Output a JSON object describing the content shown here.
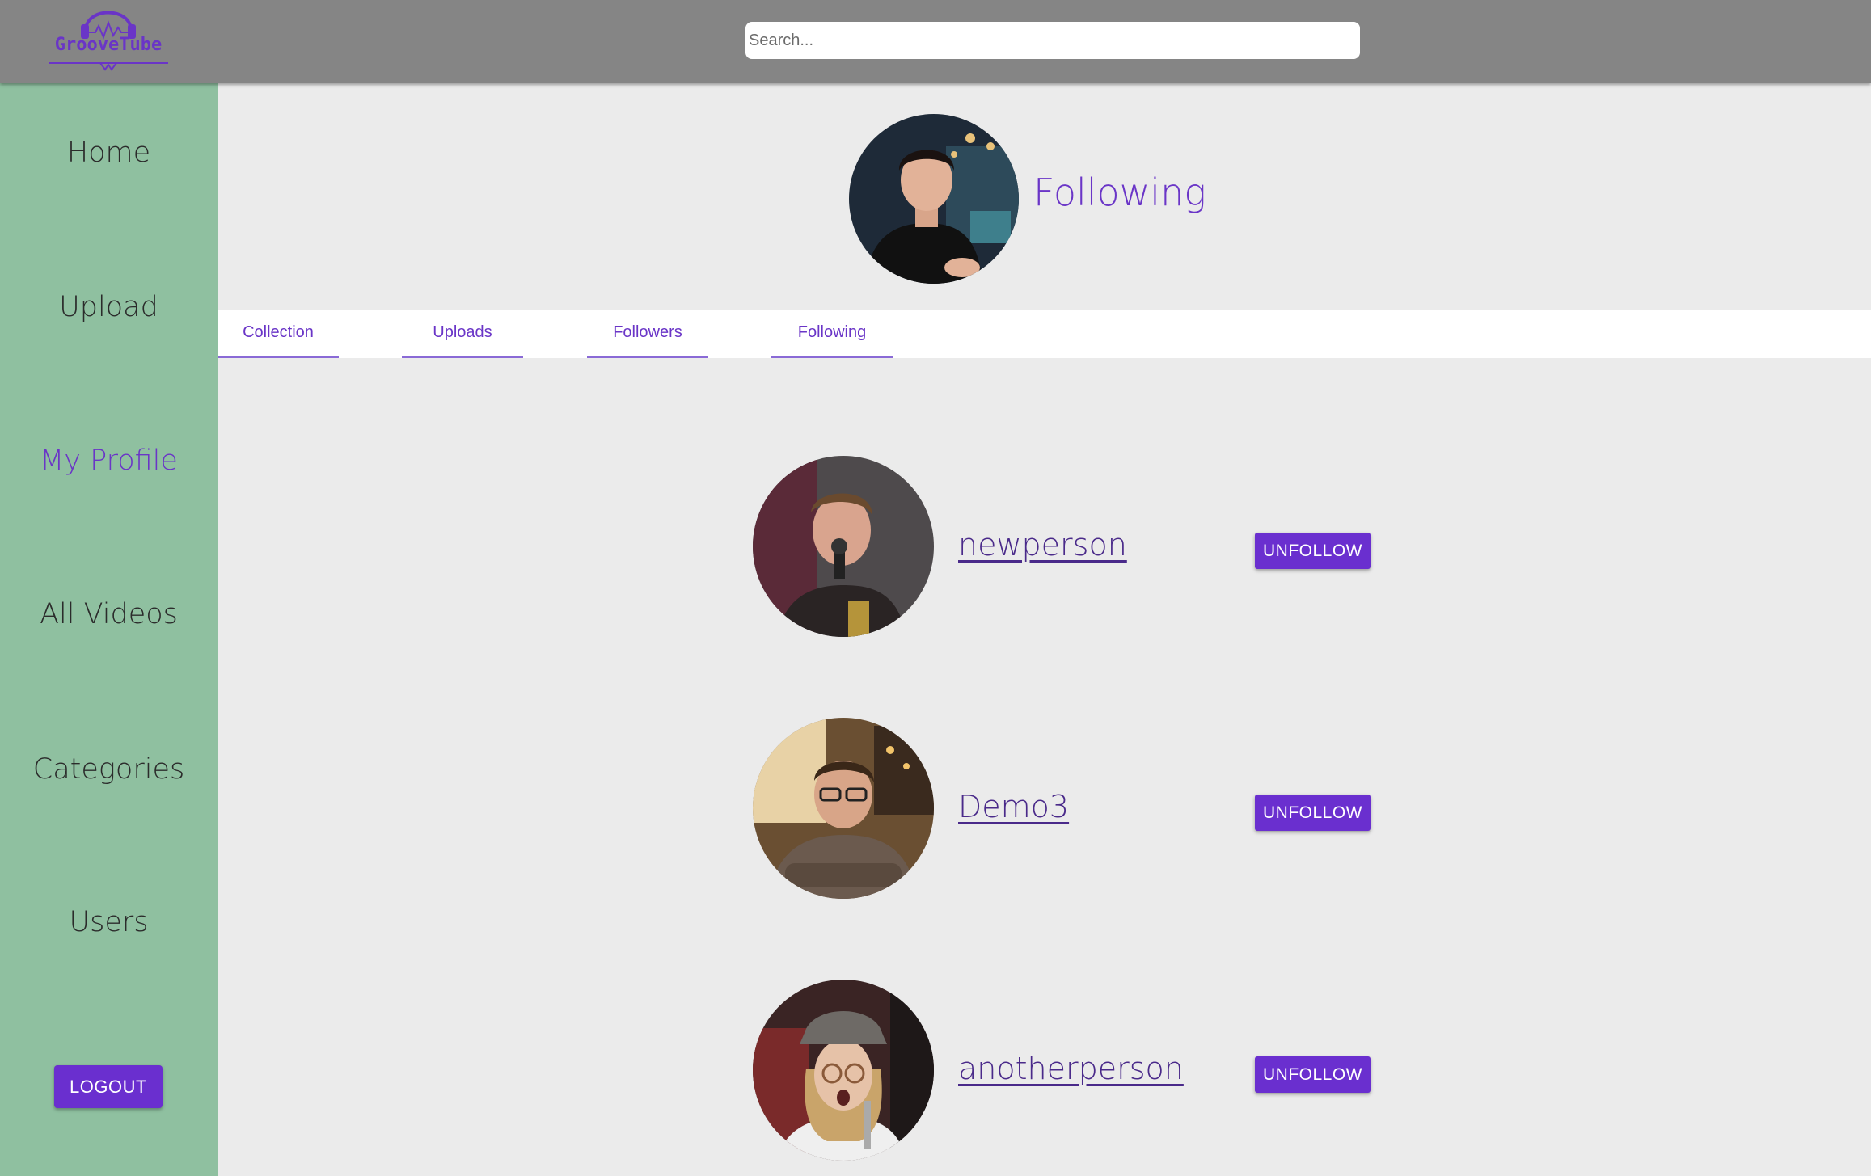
{
  "header": {
    "logo_text": "GrooveTube",
    "search": {
      "placeholder": "Search...",
      "value": ""
    }
  },
  "sidebar": {
    "items": [
      {
        "label": "Home",
        "active": false
      },
      {
        "label": "Upload",
        "active": false
      },
      {
        "label": "My Profile",
        "active": true
      },
      {
        "label": "All Videos",
        "active": false
      },
      {
        "label": "Categories",
        "active": false
      },
      {
        "label": "Users",
        "active": false
      }
    ],
    "logout_label": "LOGOUT"
  },
  "profile": {
    "title": "Following",
    "tabs": [
      {
        "label": "Collection"
      },
      {
        "label": "Uploads"
      },
      {
        "label": "Followers"
      },
      {
        "label": "Following"
      }
    ]
  },
  "following": [
    {
      "name": "newperson",
      "button_label": "UNFOLLOW"
    },
    {
      "name": "Demo3",
      "button_label": "UNFOLLOW"
    },
    {
      "name": "anotherperson",
      "button_label": "UNFOLLOW"
    }
  ],
  "colors": {
    "accent": "#6a2fcf",
    "header_bg": "#858585",
    "sidebar_bg": "#8fc0a0",
    "page_bg": "#ebebeb"
  }
}
